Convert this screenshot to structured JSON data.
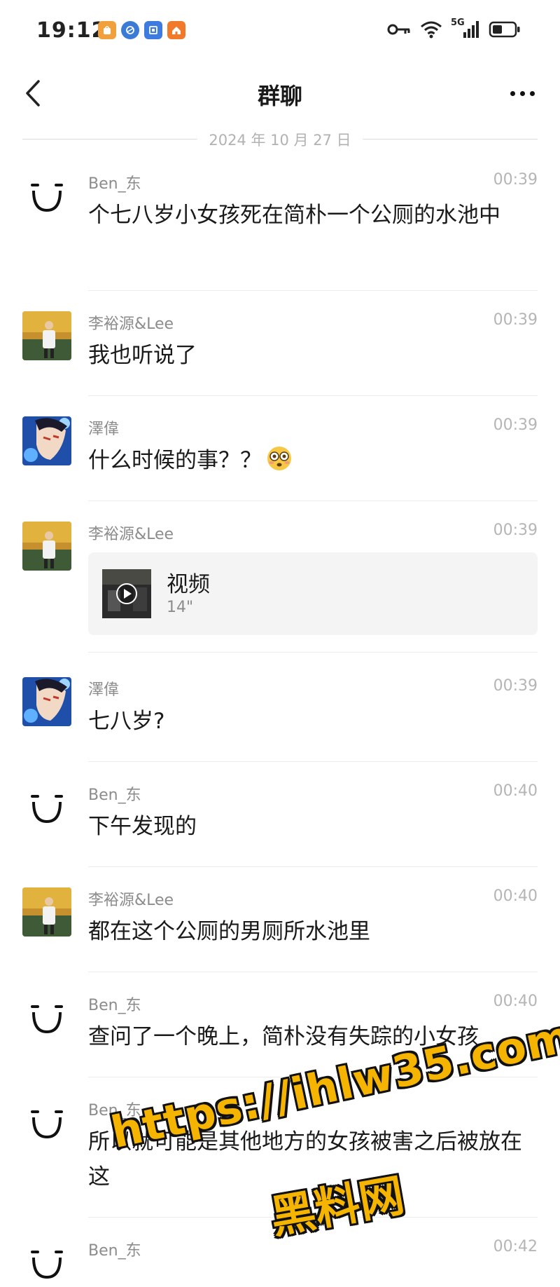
{
  "status_bar": {
    "time": "19:12",
    "network": "5G",
    "apps": [
      {
        "icon": "shopping-bag-icon",
        "color": "#f0a03c"
      },
      {
        "icon": "browser-icon",
        "color": "#3a7bd5"
      },
      {
        "icon": "office-icon",
        "color": "#3e7be0"
      },
      {
        "icon": "home-app-icon",
        "color": "#f07a2a"
      }
    ]
  },
  "header": {
    "title": "群聊",
    "back_icon": "chevron-left-icon",
    "more_icon": "more-dots-icon"
  },
  "date_separator": "2024 年 10 月 27 日",
  "messages": [
    {
      "sender": "Ben_东",
      "time": "00:39",
      "text": "个七八岁小女孩死在简朴一个公厕的水池中",
      "avatar": "smiley-face-avatar"
    },
    {
      "sender": "李裕源&Lee",
      "time": "00:39",
      "text": "我也听说了",
      "avatar": "photo-avatar-lee"
    },
    {
      "sender": "澤偉",
      "time": "00:39",
      "text": "什么时候的事？？",
      "avatar": "anime-avatar-zewei",
      "emoji": "flushed-face-emoji"
    },
    {
      "sender": "李裕源&Lee",
      "time": "00:39",
      "video": {
        "title": "视频",
        "duration": "14\""
      },
      "avatar": "photo-avatar-lee"
    },
    {
      "sender": "澤偉",
      "time": "00:39",
      "text": "七八岁?",
      "avatar": "anime-avatar-zewei"
    },
    {
      "sender": "Ben_东",
      "time": "00:40",
      "text": "下午发现的",
      "avatar": "smiley-face-avatar"
    },
    {
      "sender": "李裕源&Lee",
      "time": "00:40",
      "text": "都在这个公厕的男厕所水池里",
      "avatar": "photo-avatar-lee"
    },
    {
      "sender": "Ben_东",
      "time": "00:40",
      "text": "查问了一个晚上，简朴没有失踪的小女孩",
      "avatar": "smiley-face-avatar"
    },
    {
      "sender": "Ben_东",
      "time": "",
      "text": "所以就可能是其他地方的女孩被害之后被放在这",
      "avatar": "smiley-face-avatar"
    },
    {
      "sender": "Ben_东",
      "time": "00:42",
      "text": "",
      "avatar": "smiley-face-avatar"
    }
  ],
  "watermark": {
    "url": "https://ihlw35.com",
    "name": "黑料网"
  }
}
